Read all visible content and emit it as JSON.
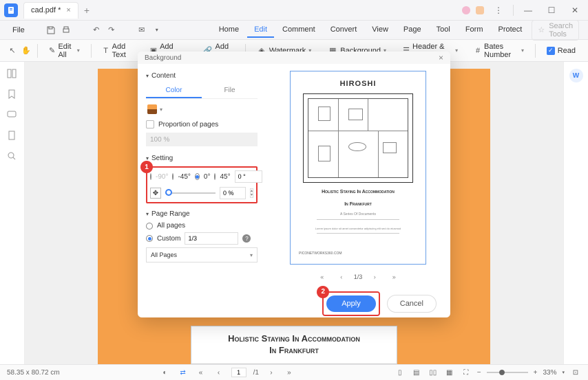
{
  "titlebar": {
    "tab_name": "cad.pdf *"
  },
  "menubar": {
    "file": "File",
    "items": [
      "Home",
      "Edit",
      "Comment",
      "Convert",
      "View",
      "Page",
      "Tool",
      "Form",
      "Protect"
    ],
    "active_index": 1,
    "search_placeholder": "Search Tools"
  },
  "toolbar": {
    "edit_all": "Edit All",
    "add_text": "Add Text",
    "add_image": "Add Image",
    "add_link": "Add Link",
    "watermark": "Watermark",
    "background": "Background",
    "header_footer": "Header & Footer",
    "bates_number": "Bates Number",
    "read": "Read"
  },
  "page_content": {
    "heading_line1": "Holistic Staying In Accommodation",
    "heading_line2": "In Frankfurt"
  },
  "dialog": {
    "title": "Background",
    "sections": {
      "content": "Content",
      "setting": "Setting",
      "page_range": "Page Range"
    },
    "tabs": {
      "color": "Color",
      "file": "File"
    },
    "proportion_label": "Proportion of pages",
    "proportion_value": "100 %",
    "angles": {
      "n90": "-90°",
      "n45": "-45°",
      "zero": "0°",
      "p45": "45°",
      "custom": "0 °"
    },
    "opacity_value": "0 %",
    "page_range": {
      "all": "All pages",
      "custom": "Custom",
      "custom_value": "1/3",
      "select_label": "All Pages"
    },
    "preview": {
      "title": "HIROSHI",
      "sub1": "Holistic Staying In Accommodation",
      "sub2": "In Frankfurt",
      "byline": "A Series Of Documents",
      "footer": "piconetworks360.com"
    },
    "pager": {
      "current": "1",
      "total": "/3"
    },
    "apply": "Apply",
    "cancel": "Cancel"
  },
  "markers": {
    "m1": "1",
    "m2": "2"
  },
  "statusbar": {
    "dimensions": "58.35 x 80.72 cm",
    "page_current": "1",
    "page_total": "/1",
    "zoom": "33%"
  }
}
